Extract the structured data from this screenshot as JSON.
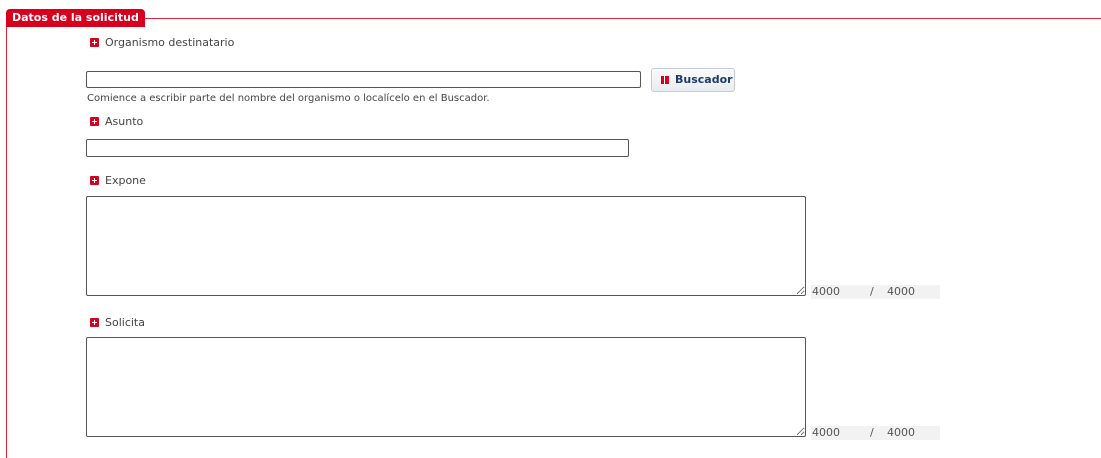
{
  "section": {
    "legend": "Datos de la solicitud"
  },
  "organismo": {
    "label": "Organismo destinatario",
    "value": "",
    "hint": "Comience a escribir parte del nombre del organismo o localícelo en el Buscador.",
    "search_button": "Buscador"
  },
  "asunto": {
    "label": "Asunto",
    "value": ""
  },
  "expone": {
    "label": "Expone",
    "value": "",
    "remaining": "4000",
    "separator": "/",
    "max": "4000"
  },
  "solicita": {
    "label": "Solicita",
    "value": "",
    "remaining": "4000",
    "separator": "/",
    "max": "4000"
  },
  "colors": {
    "accent": "#d7001f",
    "button_text": "#1e3a6b"
  }
}
